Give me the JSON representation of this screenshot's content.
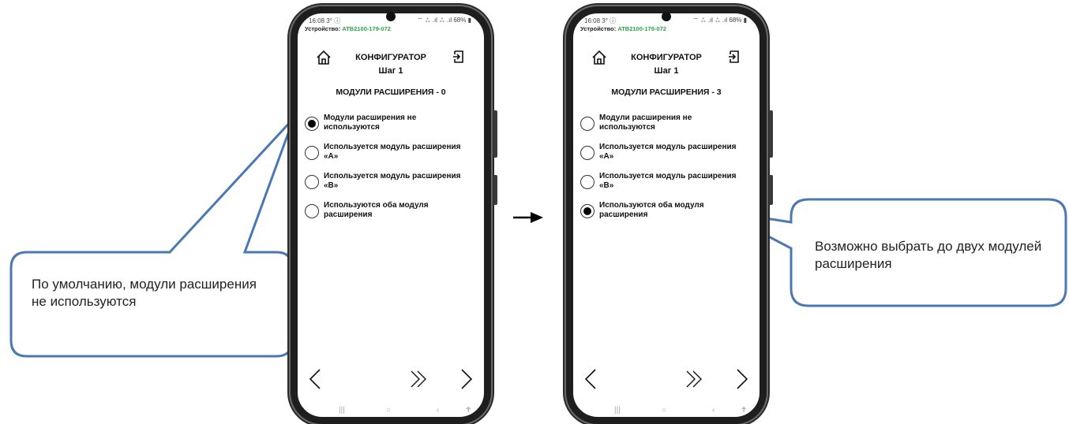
{
  "phones": [
    {
      "status_time": "16:08 3° ⓘ",
      "status_right": "⌔ ⁂ .ıl ⁂ .ıl 68% ▮",
      "device_label": "Устройство: ",
      "device_id": "ATB2100-179-072",
      "title": "КОНФИГУРАТОР",
      "step": "Шаг 1",
      "section": "МОДУЛИ РАСШИРЕНИЯ - 0",
      "options": [
        {
          "label": "Модули расширения не используются",
          "checked": true
        },
        {
          "label": "Используется модуль расширения «А»",
          "checked": false
        },
        {
          "label": "Используется модуль расширения «В»",
          "checked": false
        },
        {
          "label": "Используются оба модуля расширения",
          "checked": false
        }
      ]
    },
    {
      "status_time": "16:08 3° ⓘ",
      "status_right": "⌔ ⁂ .ıl ⁂ .ıl 68% ▮",
      "device_label": "Устройство: ",
      "device_id": "ATB2100-179-072",
      "title": "КОНФИГУРАТОР",
      "step": "Шаг 1",
      "section": "МОДУЛИ РАСШИРЕНИЯ - 3",
      "options": [
        {
          "label": "Модули расширения не используются",
          "checked": false
        },
        {
          "label": "Используется модуль расширения «А»",
          "checked": false
        },
        {
          "label": "Используется модуль расширения «В»",
          "checked": false
        },
        {
          "label": "Используются оба модуля расширения",
          "checked": true
        }
      ]
    }
  ],
  "callouts": {
    "left": "По умолчанию, модули расширения не используются",
    "right": "Возможно выбрать до двух модулей расширения"
  },
  "colors": {
    "device_id": "#2aa44f",
    "callout_border": "#4a78b0",
    "radio_checked": "#000000"
  },
  "icons": {
    "home": "home-icon",
    "exit": "exit-icon",
    "prev": "chevron-left-icon",
    "skip": "double-chevron-right-icon",
    "next": "chevron-right-icon"
  }
}
